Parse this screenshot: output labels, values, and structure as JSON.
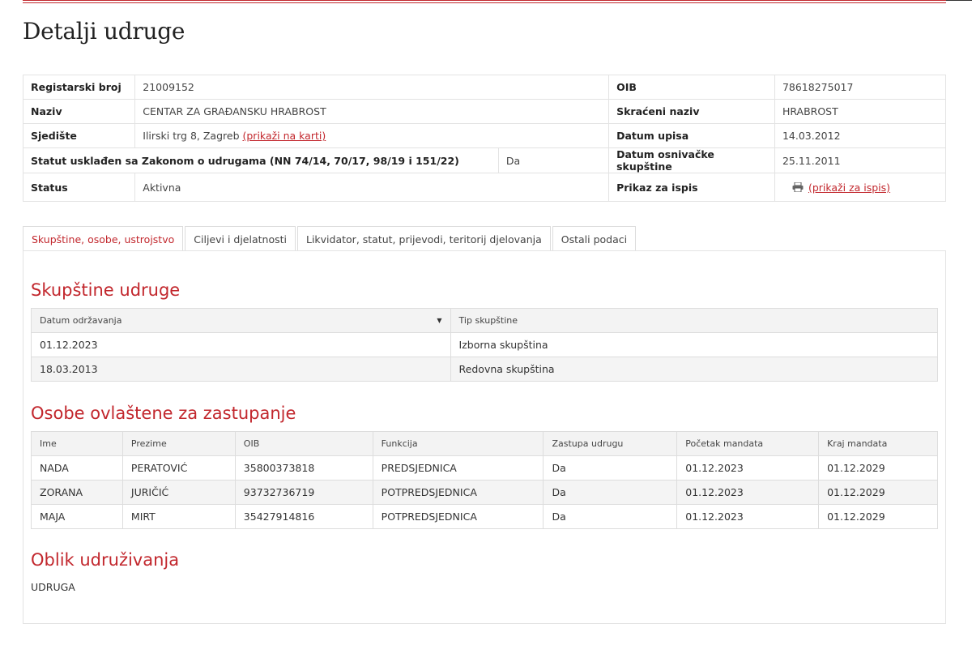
{
  "page_title": "Detalji udruge",
  "details": {
    "registarski_broj": {
      "label": "Registarski broj",
      "value": "21009152"
    },
    "oib": {
      "label": "OIB",
      "value": "78618275017"
    },
    "naziv": {
      "label": "Naziv",
      "value": "CENTAR ZA GRAĐANSKU HRABROST"
    },
    "skraceni_naziv": {
      "label": "Skraćeni naziv",
      "value": "HRABROST"
    },
    "sjediste": {
      "label": "Sjedište",
      "value": "Ilirski trg 8, Zagreb",
      "link": "(prikaži na karti)"
    },
    "datum_upisa": {
      "label": "Datum upisa",
      "value": "14.03.2012"
    },
    "statut": {
      "label": "Statut usklađen sa Zakonom o udrugama (NN 74/14, 70/17, 98/19 i 151/22)",
      "value": "Da"
    },
    "datum_osnivacke": {
      "label": "Datum osnivačke skupštine",
      "value": "25.11.2011"
    },
    "status": {
      "label": "Status",
      "value": "Aktivna"
    },
    "prikaz": {
      "label": "Prikaz za ispis",
      "link": "(prikaži za ispis)",
      "icon": "printer-icon"
    }
  },
  "tabs": [
    {
      "label": "Skupštine, osobe, ustrojstvo",
      "active": true
    },
    {
      "label": "Ciljevi i djelatnosti",
      "active": false
    },
    {
      "label": "Likvidator, statut, prijevodi, teritorij djelovanja",
      "active": false
    },
    {
      "label": "Ostali podaci",
      "active": false
    }
  ],
  "skupstine": {
    "title": "Skupštine udruge",
    "headers": [
      "Datum održavanja",
      "Tip skupštine"
    ],
    "rows": [
      [
        "01.12.2023",
        "Izborna skupština"
      ],
      [
        "18.03.2013",
        "Redovna skupština"
      ]
    ]
  },
  "osobe": {
    "title": "Osobe ovlaštene za zastupanje",
    "headers": [
      "Ime",
      "Prezime",
      "OIB",
      "Funkcija",
      "Zastupa udrugu",
      "Početak mandata",
      "Kraj mandata"
    ],
    "rows": [
      [
        "NADA",
        "PERATOVIĆ",
        "35800373818",
        "PREDSJEDNICA",
        "Da",
        "01.12.2023",
        "01.12.2029"
      ],
      [
        "ZORANA",
        "JURIČIĆ",
        "93732736719",
        "POTPREDSJEDNICA",
        "Da",
        "01.12.2023",
        "01.12.2029"
      ],
      [
        "MAJA",
        "MIRT",
        "35427914816",
        "POTPREDSJEDNICA",
        "Da",
        "01.12.2023",
        "01.12.2029"
      ]
    ]
  },
  "oblik": {
    "title": "Oblik udruživanja",
    "value": "UDRUGA"
  },
  "colors": {
    "accent": "#c2272d",
    "border": "#dddddd",
    "header_bg": "#f3f3f3"
  }
}
